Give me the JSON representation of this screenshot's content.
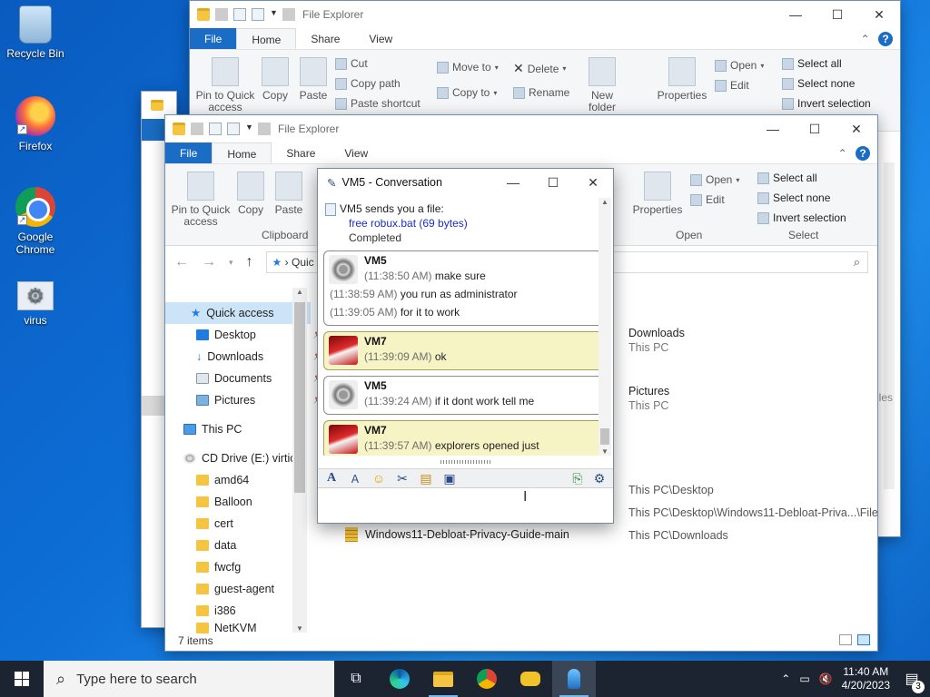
{
  "desktop": {
    "icons": [
      {
        "label": "Recycle Bin",
        "icon": "recycle-bin-icon"
      },
      {
        "label": "Firefox",
        "icon": "firefox-icon"
      },
      {
        "label": "Google Chrome",
        "icon": "chrome-icon"
      },
      {
        "label": "virus",
        "icon": "gear-file-icon"
      }
    ]
  },
  "explorer_back": {
    "title": "File Explorer",
    "tabs": [
      "File",
      "Home",
      "Share",
      "View"
    ],
    "ribbon": {
      "pin": "Pin to Quick access",
      "copy": "Copy",
      "paste": "Paste",
      "cut": "Cut",
      "copy_path": "Copy path",
      "paste_shortcut": "Paste shortcut",
      "move_to": "Move to",
      "copy_to": "Copy to",
      "delete": "Delete",
      "rename": "Rename",
      "new_folder": "New folder",
      "properties": "Properties",
      "open": "Open",
      "edit": "Edit",
      "select_all": "Select all",
      "select_none": "Select none",
      "invert_selection": "Invert selection"
    }
  },
  "explorer_front": {
    "title": "File Explorer",
    "tabs": [
      "File",
      "Home",
      "Share",
      "View"
    ],
    "ribbon": {
      "pin": "Pin to Quick access",
      "copy": "Copy",
      "paste": "Paste",
      "clipboard_group": "Clipboard",
      "properties": "Properties",
      "open": "Open",
      "edit": "Edit",
      "open_group": "Open",
      "select_all": "Select all",
      "select_none": "Select none",
      "invert_selection": "Invert selection",
      "select_group": "Select"
    },
    "address": "Quic",
    "nav": {
      "quick_access": "Quick access",
      "desktop": "Desktop",
      "downloads": "Downloads",
      "documents": "Documents",
      "pictures": "Pictures",
      "this_pc": "This PC",
      "cd_drive": "CD Drive (E:) virtic",
      "folders": [
        "amd64",
        "Balloon",
        "cert",
        "data",
        "fwcfg",
        "guest-agent",
        "i386",
        "NetKVM"
      ]
    },
    "content": {
      "items": [
        {
          "name": "Downloads",
          "sub": "This PC"
        },
        {
          "name": "Pictures",
          "sub": "This PC"
        }
      ],
      "recent": [
        {
          "name": "",
          "path": "This PC\\Desktop"
        },
        {
          "name": "",
          "path": "This PC\\Desktop\\Windows11-Debloat-Priva...\\Files"
        },
        {
          "name": "Windows11-Debloat-Privacy-Guide-main",
          "path": "This PC\\Downloads"
        }
      ]
    },
    "status": "7 items"
  },
  "conversation": {
    "title": "VM5 - Conversation",
    "file_notice": "VM5 sends you a file:",
    "file_name": "free robux.bat (69 bytes)",
    "file_status": "Completed",
    "messages": [
      {
        "sender": "VM5",
        "role": "you",
        "lines": [
          {
            "ts": "(11:38:50 AM)",
            "text": "make sure"
          },
          {
            "ts": "(11:38:59 AM)",
            "text": "you run as administrator"
          },
          {
            "ts": "(11:39:05 AM)",
            "text": "for it to work"
          }
        ]
      },
      {
        "sender": "VM7",
        "role": "me",
        "lines": [
          {
            "ts": "(11:39:09 AM)",
            "text": "ok"
          }
        ]
      },
      {
        "sender": "VM5",
        "role": "you",
        "lines": [
          {
            "ts": "(11:39:24 AM)",
            "text": "if it dont work tell me"
          }
        ]
      },
      {
        "sender": "VM7",
        "role": "me",
        "lines": [
          {
            "ts": "(11:39:57 AM)",
            "text": "explorers opened just"
          }
        ]
      }
    ]
  },
  "taskbar": {
    "search_placeholder": "Type here to search",
    "time": "11:40 AM",
    "date": "4/20/2023",
    "notification_count": "3"
  }
}
